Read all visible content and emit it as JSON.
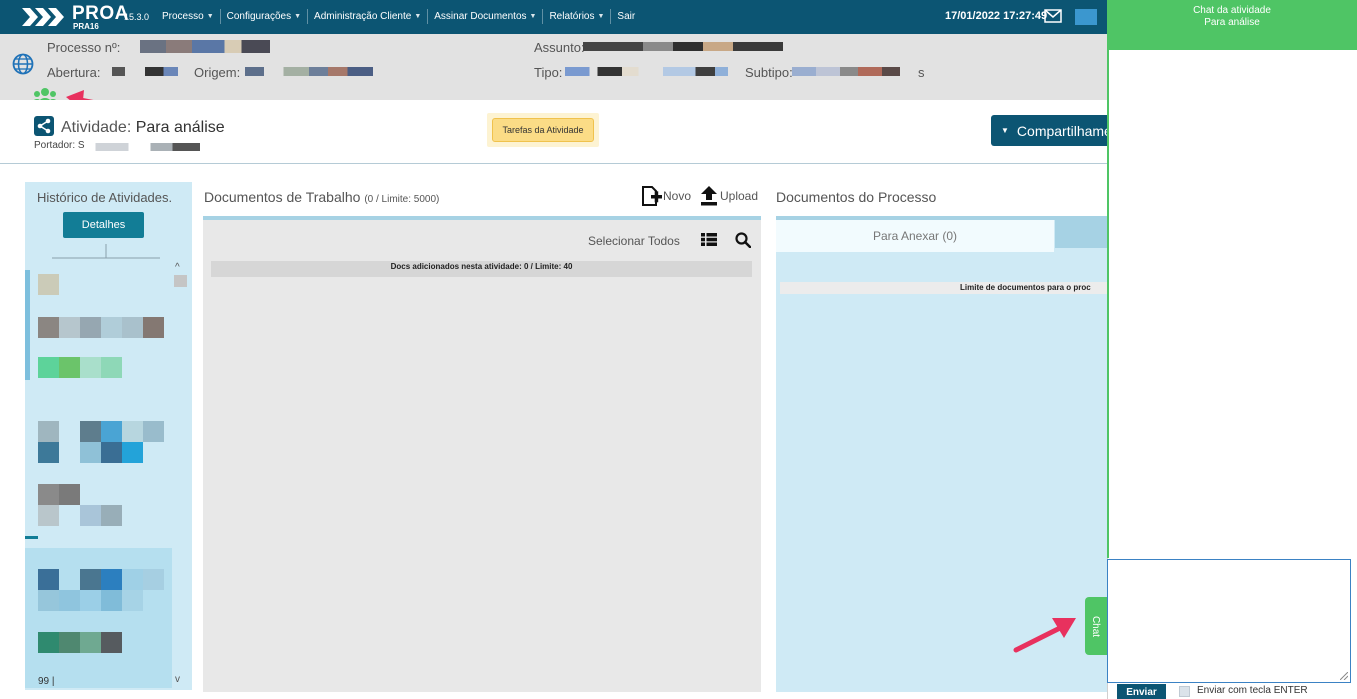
{
  "app": {
    "name": "PROA",
    "version": "15.3.0",
    "subtitle": "PRA16",
    "datetime": "17/01/2022 17:27:49"
  },
  "menu": [
    {
      "label": "Processo",
      "has_caret": true
    },
    {
      "label": "Configurações",
      "has_caret": true
    },
    {
      "label": "Administração Cliente",
      "has_caret": true
    },
    {
      "label": "Assinar Documentos",
      "has_caret": true
    },
    {
      "label": "Relatórios",
      "has_caret": true
    },
    {
      "label": "Sair",
      "has_caret": false
    }
  ],
  "process": {
    "numero_label": "Processo nº:",
    "abertura_label": "Abertura:",
    "origem_label": "Origem:",
    "assunto_label": "Assunto:",
    "tipo_label": "Tipo:",
    "subtipo_label": "Subtipo:",
    "subtipo_tail": "s"
  },
  "activity": {
    "label": "Atividade:",
    "value": "Para análise",
    "portador_label": "Portador: S",
    "tarefas_button": "Tarefas da Atividade",
    "share_button": "Compartilhame"
  },
  "history": {
    "title": "Histórico de Atividades.",
    "details_button": "Detalhes",
    "count_text": "99 |"
  },
  "work_docs": {
    "title": "Documentos de Trabalho",
    "limit_text": "(0 / Limite: 5000)",
    "novo_label": "Novo",
    "upload_label": "Upload",
    "select_all": "Selecionar Todos",
    "added_text": "Docs adicionados nesta atividade: 0 / Limite: 40"
  },
  "process_docs": {
    "title": "Documentos do Processo",
    "tab_anexar": "Para Anexar (0)",
    "limit_text": "Limite de documentos para o proc"
  },
  "chat": {
    "tab_label": "Chat",
    "header_line1": "Chat da atividade",
    "header_line2": "Para análise",
    "input_value": "",
    "send_button": "Enviar",
    "enter_label": "Enviar com tecla ENTER"
  },
  "colors": {
    "nav": "#0c5573",
    "chat_green": "#4fc565",
    "panel_blue": "#cfeaf5",
    "tarefas_yellow": "#fbdc86",
    "arrow_pink": "#e8315e"
  },
  "icons": [
    "proa-logo-icon",
    "mail-icon",
    "globe-icon",
    "people-icon",
    "share-icon",
    "new-document-icon",
    "upload-icon",
    "list-icon",
    "search-icon",
    "resize-grip-icon"
  ]
}
